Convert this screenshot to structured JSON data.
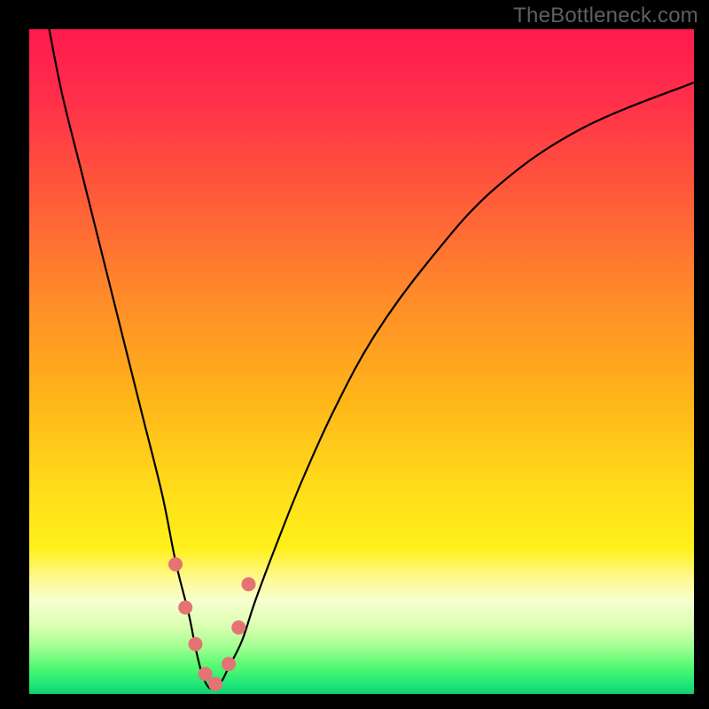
{
  "watermark": "TheBottleneck.com",
  "colors": {
    "frame": "#000000",
    "gradient_stops": [
      {
        "offset": 0.0,
        "color": "#ff1a4d"
      },
      {
        "offset": 0.1,
        "color": "#ff2e4a"
      },
      {
        "offset": 0.25,
        "color": "#ff5a3a"
      },
      {
        "offset": 0.4,
        "color": "#ff8a2a"
      },
      {
        "offset": 0.55,
        "color": "#ffb31a"
      },
      {
        "offset": 0.68,
        "color": "#ffd91a"
      },
      {
        "offset": 0.78,
        "color": "#fff01a"
      },
      {
        "offset": 0.83,
        "color": "#fff99a"
      },
      {
        "offset": 0.86,
        "color": "#f7ffd0"
      },
      {
        "offset": 0.9,
        "color": "#d8ffb0"
      },
      {
        "offset": 0.93,
        "color": "#a0ff90"
      },
      {
        "offset": 0.96,
        "color": "#50f970"
      },
      {
        "offset": 0.985,
        "color": "#20e878"
      },
      {
        "offset": 1.0,
        "color": "#10d070"
      }
    ],
    "curve": "#000000",
    "marker_fill": "#e57373",
    "marker_stroke": "#c85a5a"
  },
  "chart_data": {
    "type": "line",
    "title": "",
    "xlabel": "",
    "ylabel": "",
    "xlim": [
      0,
      100
    ],
    "ylim": [
      0,
      100
    ],
    "series": [
      {
        "name": "bottleneck-curve",
        "x": [
          3,
          5,
          8,
          11,
          14,
          17,
          20,
          22,
          24,
          25,
          26,
          27,
          28,
          29,
          30,
          32,
          34,
          37,
          41,
          46,
          52,
          60,
          70,
          83,
          100
        ],
        "values": [
          100,
          90,
          78,
          66,
          54,
          42,
          30,
          20,
          12,
          7,
          3,
          1,
          1,
          2,
          4,
          8,
          14,
          22,
          32,
          43,
          54,
          65,
          76,
          85,
          92
        ]
      }
    ],
    "markers": {
      "name": "highlight-points",
      "x": [
        22.0,
        23.5,
        25.0,
        26.5,
        28.0,
        30.0,
        31.5,
        33.0
      ],
      "values": [
        19.5,
        13.0,
        7.5,
        3.0,
        1.5,
        4.5,
        10.0,
        16.5
      ]
    }
  }
}
